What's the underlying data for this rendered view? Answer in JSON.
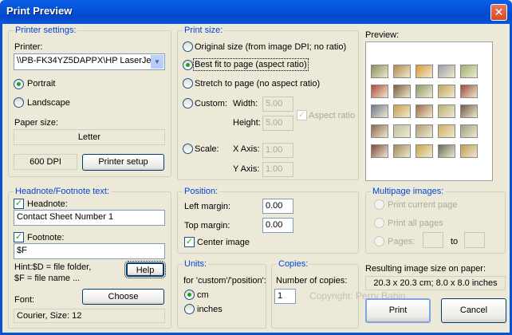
{
  "window": {
    "title": "Print Preview",
    "close_glyph": "✕"
  },
  "printer_settings": {
    "label": "Printer settings:",
    "printer_label": "Printer:",
    "printer_value": "\\\\PB-FK34YZ5DAPPX\\HP LaserJe",
    "portrait": "Portrait",
    "landscape": "Landscape",
    "paper_size_label": "Paper size:",
    "paper_size": "Letter",
    "dpi": "600 DPI",
    "setup_button": "Printer setup"
  },
  "print_size": {
    "label": "Print size:",
    "original": "Original size (from image DPI; no ratio)",
    "best_fit": "Best fit to page (aspect ratio)",
    "stretch": "Stretch to page (no aspect ratio)",
    "custom": "Custom:",
    "width_label": "Width:",
    "width_value": "5.00",
    "height_label": "Height:",
    "height_value": "5.00",
    "aspect_ratio": "Aspect ratio",
    "scale": "Scale:",
    "x_axis_label": "X Axis:",
    "x_axis_value": "1.00",
    "y_axis_label": "Y Axis:",
    "y_axis_value": "1.00"
  },
  "preview": {
    "label": "Preview:"
  },
  "headnote": {
    "label": "Headnote/Footnote text:",
    "headnote_label": "Headnote:",
    "headnote_value": "Contact Sheet Number 1",
    "footnote_label": "Footnote:",
    "footnote_value": "$F",
    "hint_line1": "Hint:$D = file folder,",
    "hint_line2": "$F = file name ...",
    "help_button": "Help",
    "font_label": "Font:",
    "choose_button": "Choose",
    "font_value": "Courier, Size: 12"
  },
  "position": {
    "label": "Position:",
    "left_margin_label": "Left margin:",
    "left_margin_value": "0.00",
    "top_margin_label": "Top margin:",
    "top_margin_value": "0.00",
    "center_image": "Center image"
  },
  "units": {
    "label": "Units:",
    "description": "for 'custom'/'position':",
    "cm": "cm",
    "inches": "inches"
  },
  "copies": {
    "label": "Copies:",
    "number_label": "Number of copies:",
    "number_value": "1"
  },
  "multipage": {
    "label": "Multipage images:",
    "current": "Print current page",
    "all": "Print all pages",
    "pages": "Pages:",
    "to": "to"
  },
  "result": {
    "label": "Resulting image size on paper:",
    "value": "20.3 x 20.3 cm; 8.0 x 8.0 inches"
  },
  "footer": {
    "copyright": "Copyright: Perry Babin",
    "print_button": "Print",
    "cancel_button": "Cancel"
  },
  "thumbnail_colors": [
    "#8a8f5a",
    "#b08a4a",
    "#d89a3a",
    "#9aa0a8",
    "#a0b070",
    "#b04a3a",
    "#7a5a3a",
    "#8a9a6a",
    "#c0a860",
    "#9a4a3a",
    "#6a7a8a",
    "#c8a050",
    "#a06a4a",
    "#b8b070",
    "#705a4a",
    "#8a6a4a",
    "#c0c0a0",
    "#b0a070",
    "#d0b060",
    "#9aa080",
    "#7a4a3a",
    "#a08a5a",
    "#c8a848",
    "#6a6a5a",
    "#c09a50"
  ]
}
